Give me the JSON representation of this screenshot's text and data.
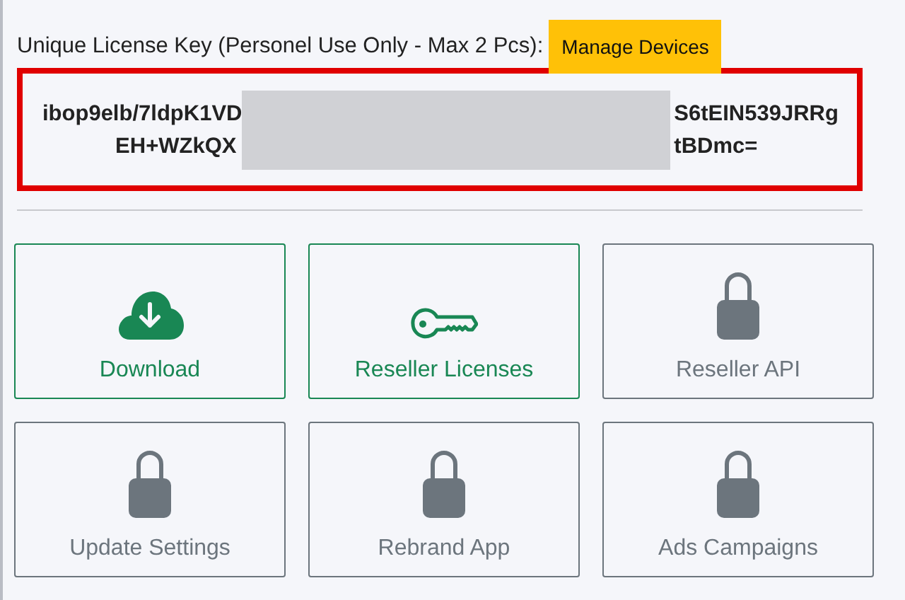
{
  "license": {
    "label": "Unique License Key (Personel Use Only - Max 2 Pcs):",
    "button": "Manage Devices",
    "key_lines": [
      {
        "start": "ibop9elb/7ldpK1VD",
        "end": "S6tEIN539JRRg"
      },
      {
        "start": "EH+WZkQX",
        "end": "tBDmc="
      }
    ]
  },
  "tiles": [
    {
      "kind": "download",
      "label": "Download",
      "enabled": true
    },
    {
      "kind": "key",
      "label": "Reseller Licenses",
      "enabled": true
    },
    {
      "kind": "lock",
      "label": "Reseller API",
      "enabled": false
    },
    {
      "kind": "lock",
      "label": "Update Settings",
      "enabled": false
    },
    {
      "kind": "lock",
      "label": "Rebrand App",
      "enabled": false
    },
    {
      "kind": "lock",
      "label": "Ads Campaigns",
      "enabled": false
    }
  ]
}
